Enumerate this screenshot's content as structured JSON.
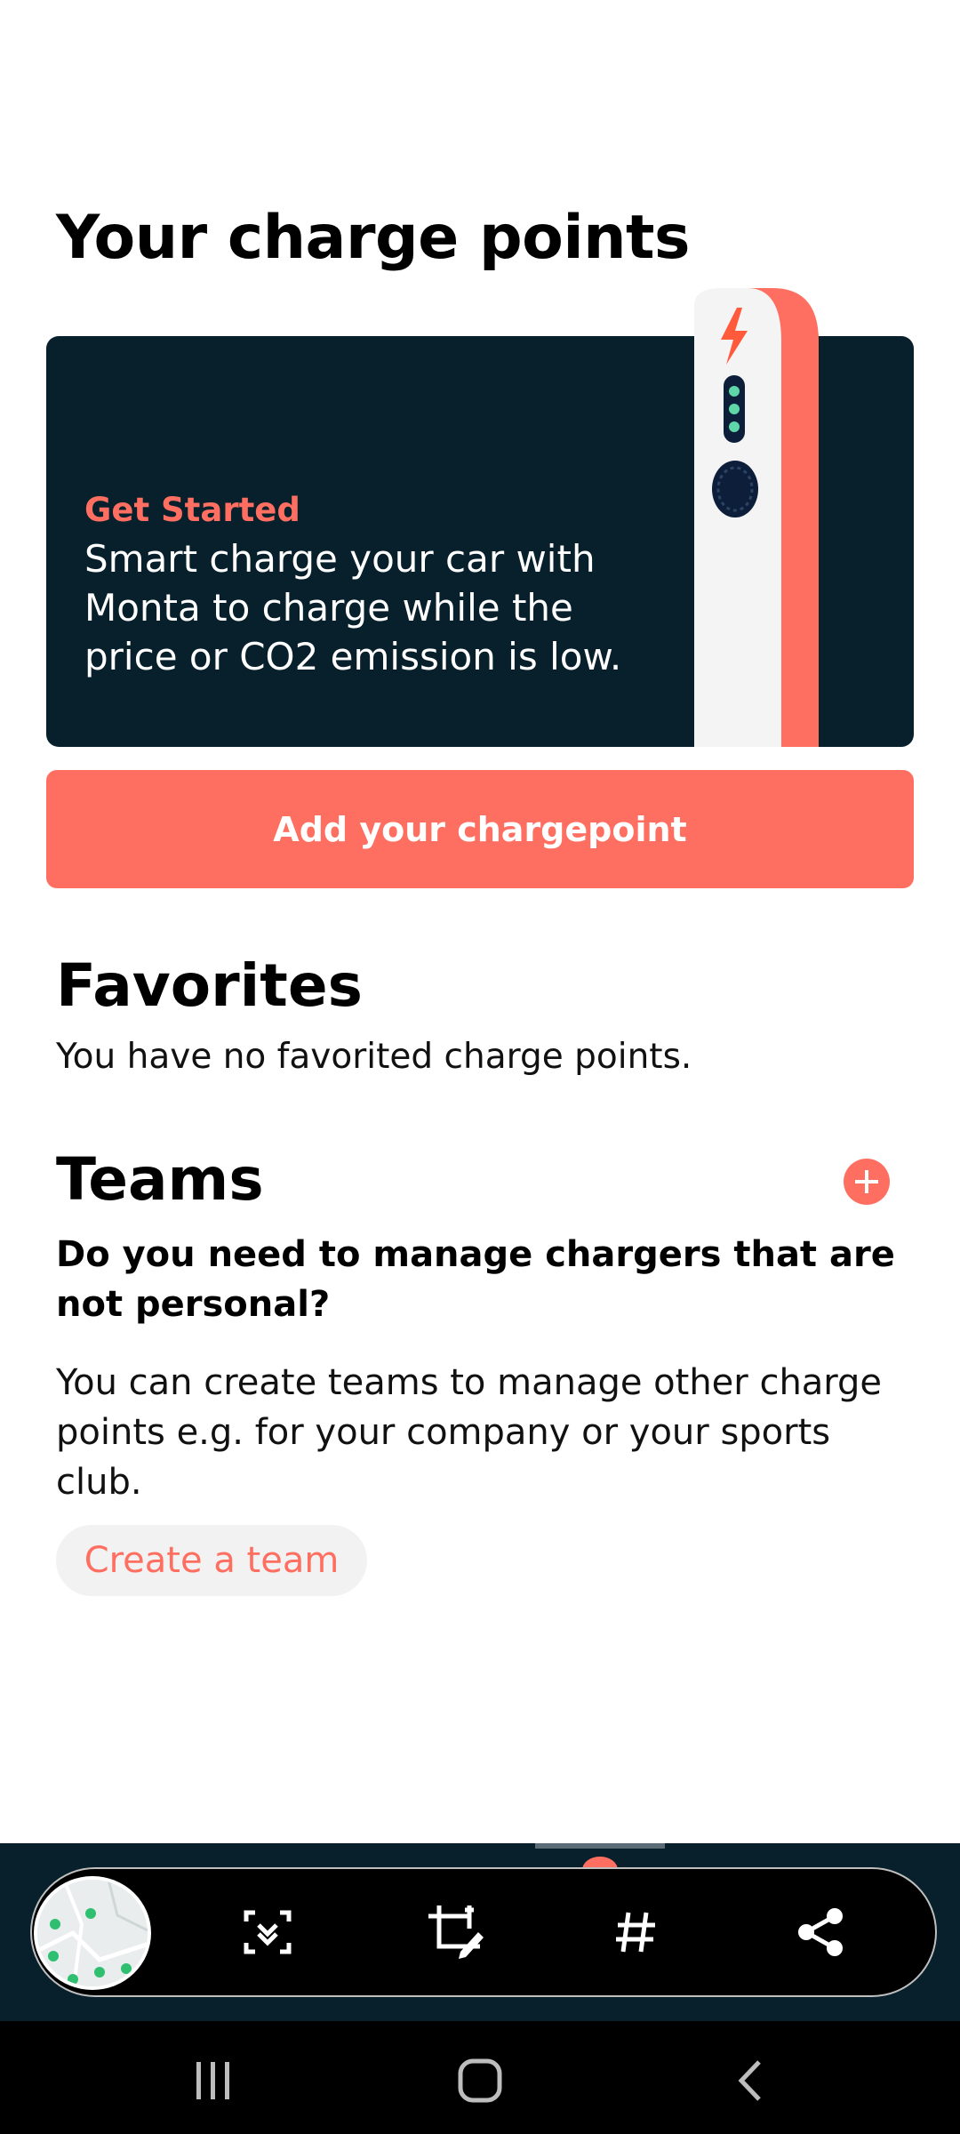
{
  "header": {
    "title": "Your charge points"
  },
  "promo": {
    "eyebrow": "Get Started",
    "body": "Smart charge your car with Monta to charge while the price or CO2 emission is low.",
    "illustration": "wall-charger-illustration"
  },
  "actions": {
    "add_chargepoint_label": "Add your chargepoint"
  },
  "favorites": {
    "title": "Favorites",
    "empty_text": "You have no favorited charge points."
  },
  "teams": {
    "title": "Teams",
    "add_icon": "plus-circle-icon",
    "question": "Do you need to manage chargers that are not personal?",
    "description": "You can create teams to manage other charge points e.g. for your company or your sports club.",
    "create_label": "Create a team"
  },
  "screenshot_toolbar": {
    "thumbnail": "map-thumbnail",
    "tools": [
      "scroll-capture-icon",
      "crop-edit-icon",
      "hashtag-icon",
      "share-icon"
    ]
  },
  "system_nav": {
    "buttons": [
      "recents-icon",
      "home-icon",
      "back-icon"
    ]
  },
  "colors": {
    "accent": "#FF6F61",
    "dark": "#08202C",
    "white": "#FFFFFF"
  }
}
